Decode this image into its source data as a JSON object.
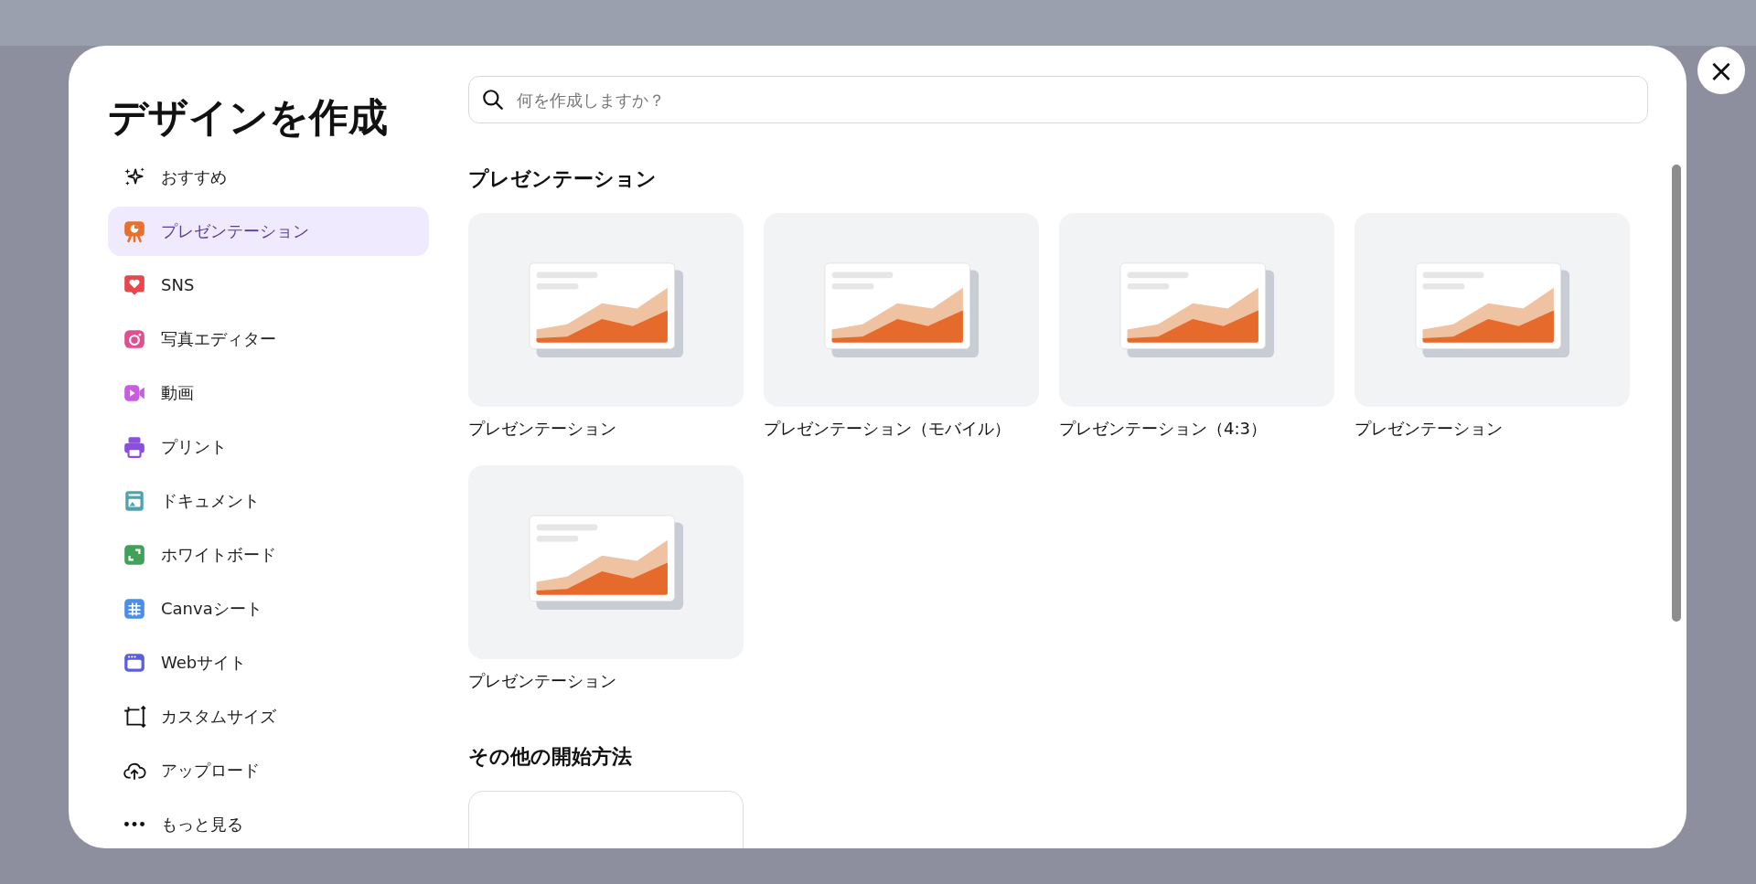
{
  "dialog": {
    "title": "デザインを作成",
    "close_button": "×"
  },
  "sidebar": {
    "items": [
      {
        "label": "おすすめ",
        "kind": "sparkle",
        "selected": false
      },
      {
        "label": "プレゼンテーション",
        "kind": "presentation",
        "selected": true
      },
      {
        "label": "SNS",
        "kind": "social",
        "selected": false
      },
      {
        "label": "写真エディター",
        "kind": "photo",
        "selected": false
      },
      {
        "label": "動画",
        "kind": "video",
        "selected": false
      },
      {
        "label": "プリント",
        "kind": "print",
        "selected": false
      },
      {
        "label": "ドキュメント",
        "kind": "document",
        "selected": false
      },
      {
        "label": "ホワイトボード",
        "kind": "whiteboard",
        "selected": false
      },
      {
        "label": "Canvaシート",
        "kind": "sheet",
        "selected": false
      },
      {
        "label": "Webサイト",
        "kind": "website",
        "selected": false
      },
      {
        "label": "カスタムサイズ",
        "kind": "resize",
        "selected": false
      },
      {
        "label": "アップロード",
        "kind": "upload",
        "selected": false
      },
      {
        "label": "もっと見る",
        "kind": "more",
        "selected": false
      }
    ]
  },
  "search": {
    "placeholder": "何を作成しますか？"
  },
  "sections": [
    {
      "title": "プレゼンテーション",
      "cards": [
        {
          "label": "プレゼンテーション"
        },
        {
          "label": "プレゼンテーション（モバイル）"
        },
        {
          "label": "プレゼンテーション（4:3）"
        },
        {
          "label": "プレゼンテーション"
        },
        {
          "label": "プレゼンテーション"
        }
      ]
    },
    {
      "title": "その他の開始方法",
      "cards": [
        {
          "kind": "blank"
        }
      ]
    }
  ]
}
